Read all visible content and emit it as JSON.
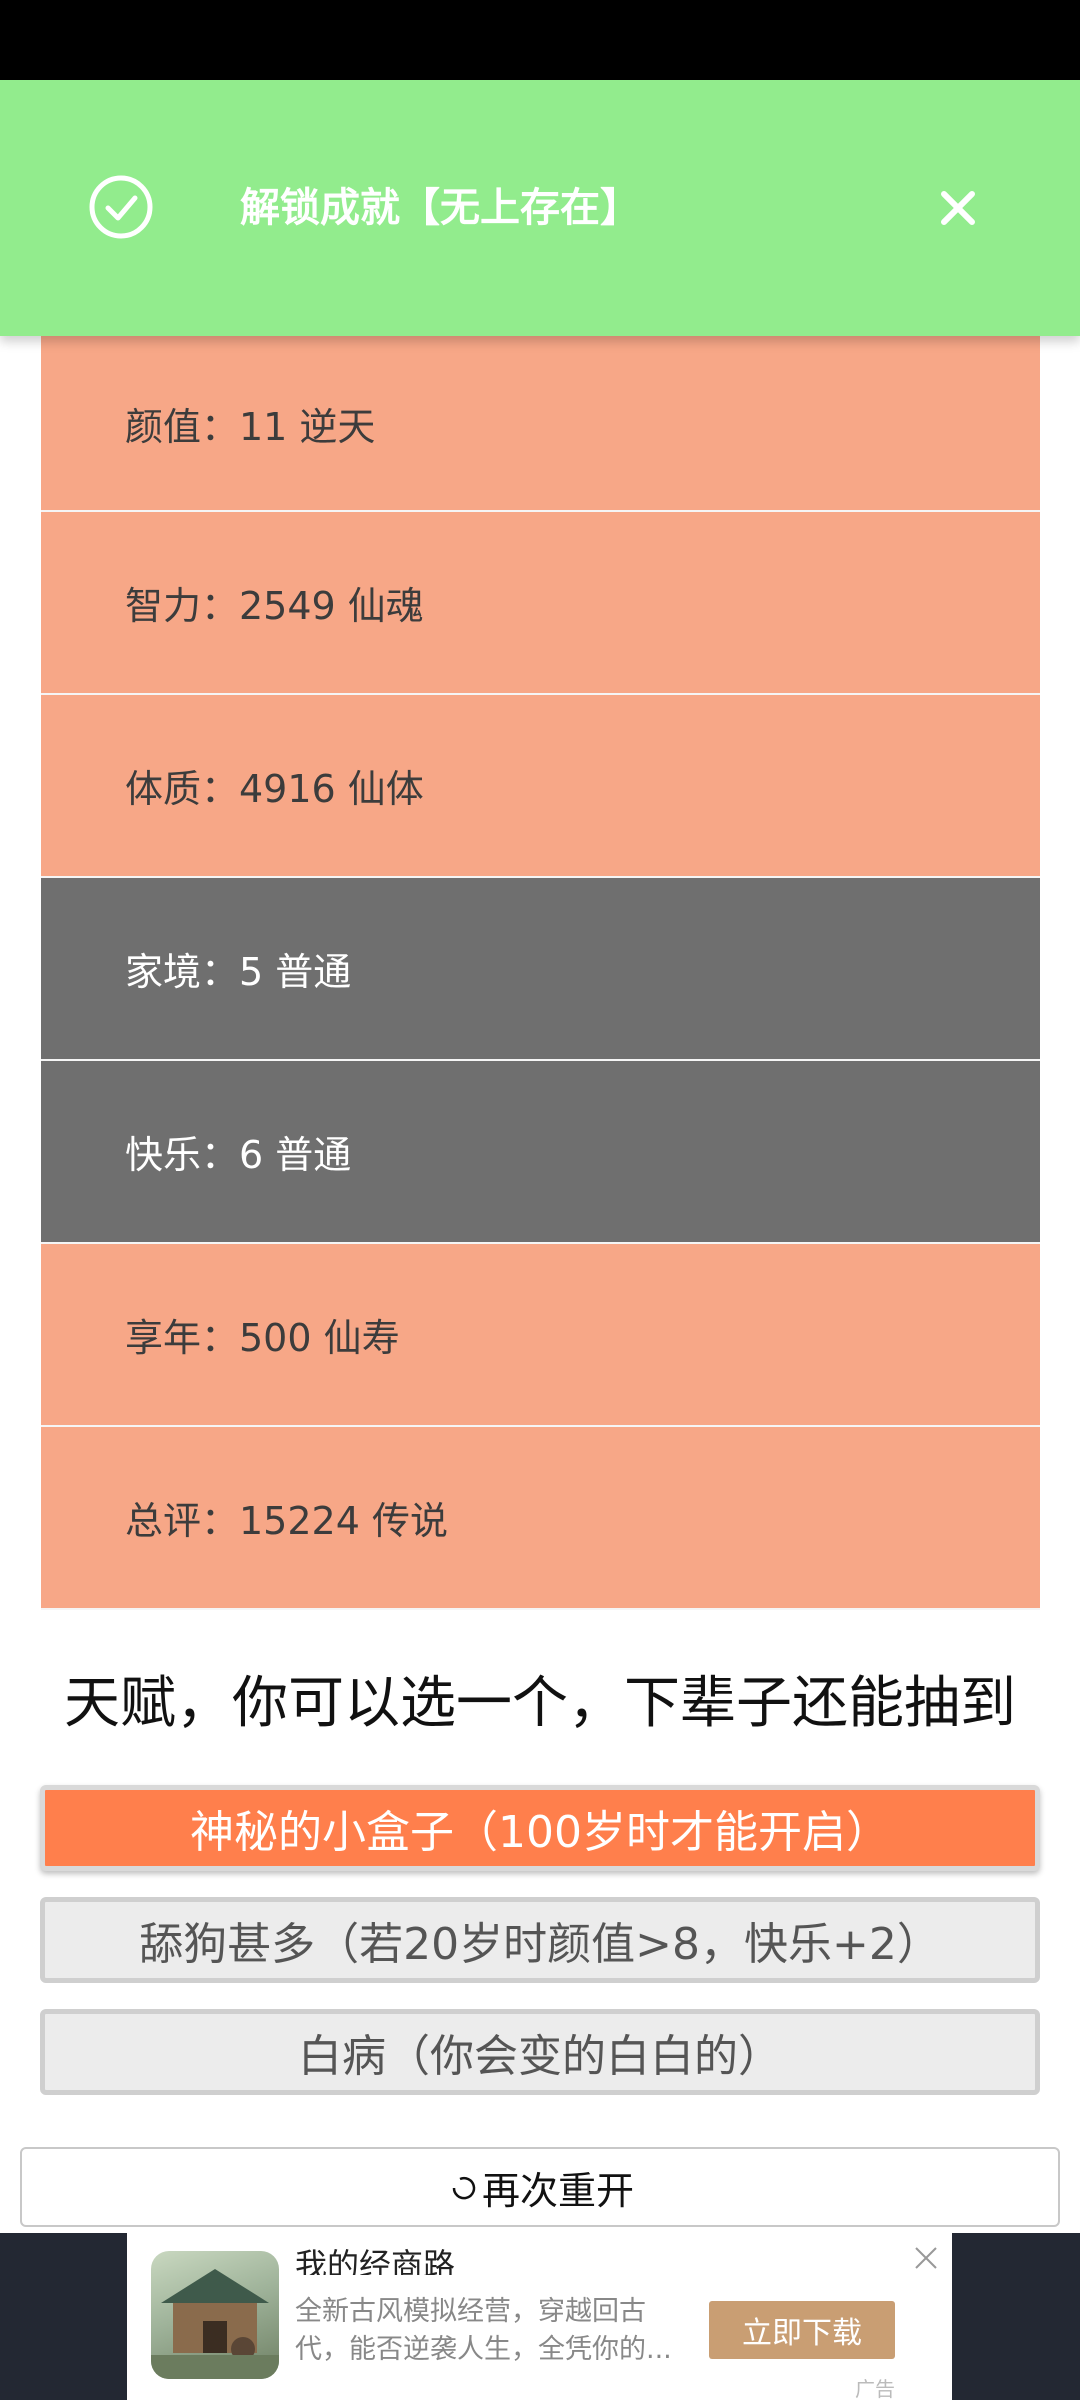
{
  "toast": {
    "title": "解锁成就【无上存在】"
  },
  "stats": [
    {
      "label": "颜值：11 逆天",
      "tier": "legend"
    },
    {
      "label": "智力：2549 仙魂",
      "tier": "legend"
    },
    {
      "label": "体质：4916 仙体",
      "tier": "legend"
    },
    {
      "label": "家境：5 普通",
      "tier": "normal"
    },
    {
      "label": "快乐：6 普通",
      "tier": "normal"
    },
    {
      "label": "享年：500 仙寿",
      "tier": "legend"
    },
    {
      "label": "总评：15224 传说",
      "tier": "legend"
    }
  ],
  "talents": {
    "heading": "天赋，你可以选一个，下辈子还能抽到",
    "options": [
      {
        "label": "神秘的小盒子（100岁时才能开启）",
        "selected": true
      },
      {
        "label": "舔狗甚多（若20岁时颜值>8，快乐+2）",
        "selected": false
      },
      {
        "label": "白病（你会变的白白的）",
        "selected": false
      }
    ]
  },
  "restart": {
    "label": "再次重开"
  },
  "ad": {
    "title": "我的经商路",
    "description": "全新古风模拟经营，穿越回古代，能否逆袭人生，全凭你的...",
    "download_label": "立即下载",
    "tag": "广告"
  },
  "colors": {
    "toast_bg": "#92ec8d",
    "legend_row": "#f7a787",
    "normal_row": "#6f6f6f",
    "selected_talent": "#ff7f4c",
    "ad_button": "#c99e73"
  }
}
